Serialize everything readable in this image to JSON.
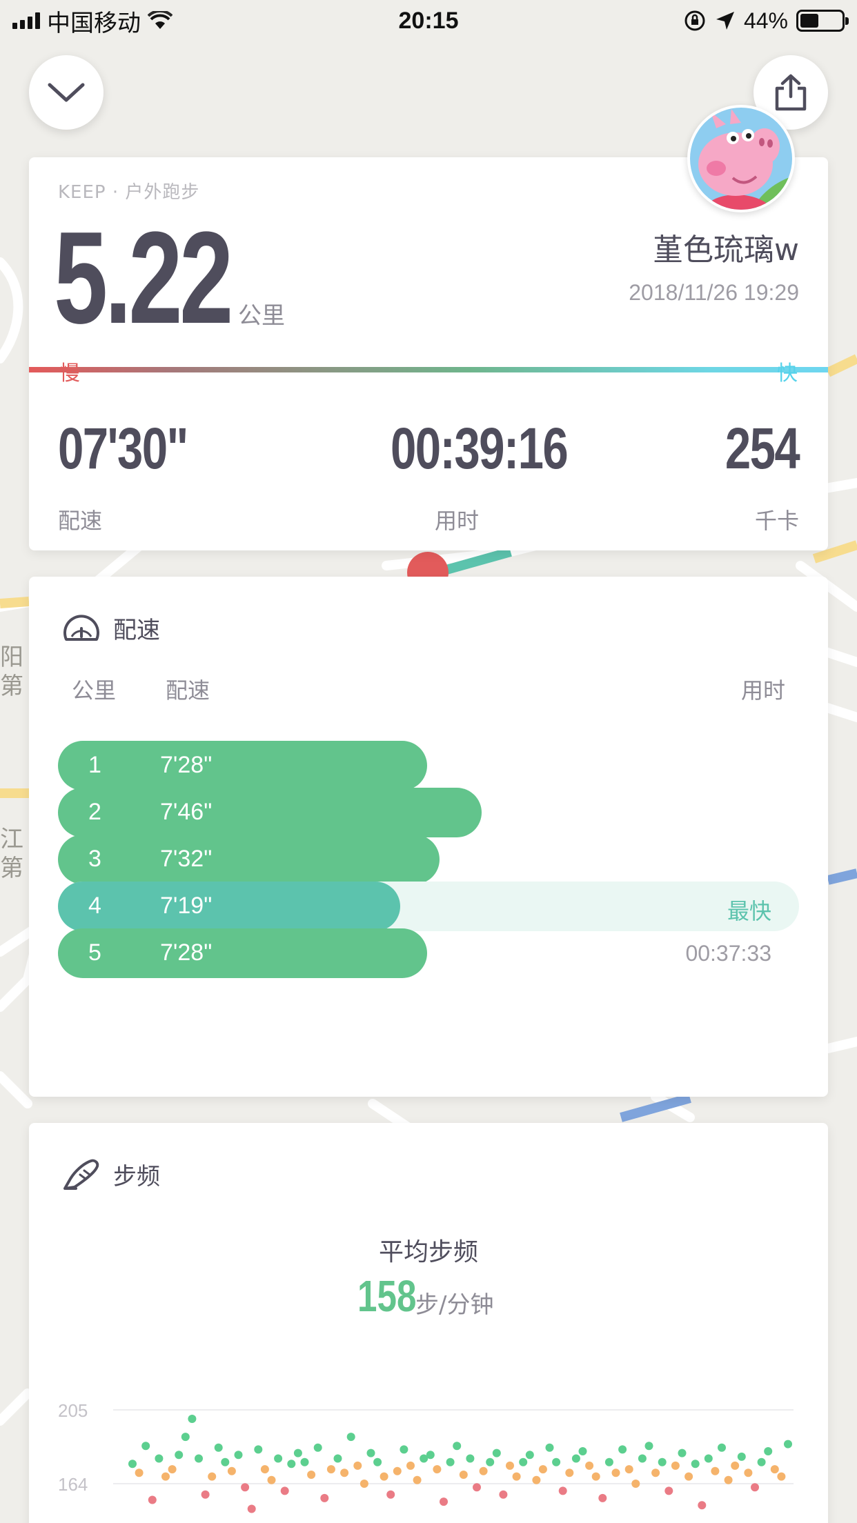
{
  "status_bar": {
    "carrier": "中国移动",
    "time": "20:15",
    "battery": "44%",
    "battery_level": 0.44
  },
  "icons": {
    "collapse": "chevron-down-icon",
    "share": "share-icon",
    "speedometer": "speedometer-icon",
    "shoe": "shoe-icon"
  },
  "summary": {
    "source": "KEEP · 户外跑步",
    "distance": "5.22",
    "distance_unit": "公里",
    "username": "堇色琉璃w",
    "datetime": "2018/11/26 19:29",
    "slow_label": "慢",
    "fast_label": "快",
    "stats": {
      "pace": {
        "value": "07'30\"",
        "label": "配速"
      },
      "duration": {
        "value": "00:39:16",
        "label": "用时"
      },
      "calories": {
        "value": "254",
        "label": "千卡"
      }
    }
  },
  "pace_card": {
    "title": "配速",
    "columns": {
      "km": "公里",
      "pace": "配速",
      "time": "用时"
    },
    "splits": [
      {
        "km": "1",
        "pace": "7'28\"",
        "seconds": 448,
        "note": ""
      },
      {
        "km": "2",
        "pace": "7'46\"",
        "seconds": 466,
        "note": ""
      },
      {
        "km": "3",
        "pace": "7'32\"",
        "seconds": 452,
        "note": ""
      },
      {
        "km": "4",
        "pace": "7'19\"",
        "seconds": 439,
        "note": "最快",
        "fastest": true
      },
      {
        "km": "5",
        "pace": "7'28\"",
        "seconds": 448,
        "note": "00:37:33"
      }
    ]
  },
  "cadence_card": {
    "title": "步频",
    "avg_title": "平均步频",
    "avg_value": "158",
    "avg_unit": "步/分钟",
    "colors": {
      "high": "#5ccf8f",
      "mid": "#f5b36b",
      "low": "#ea7b85"
    }
  },
  "chart_data": {
    "type": "scatter",
    "title": "",
    "xlabel": "",
    "ylabel": "",
    "y_ticks": [
      "205",
      "164"
    ],
    "ylim": [
      140,
      205
    ],
    "series": [
      {
        "name": "",
        "values": [
          175,
          170,
          185,
          155,
          178,
          168,
          172,
          180,
          190,
          200,
          178,
          158,
          168,
          184,
          176,
          171,
          180,
          162,
          150,
          183,
          172,
          166,
          178,
          160,
          175,
          181,
          176,
          169,
          184,
          156,
          172,
          178,
          170,
          190,
          174,
          164,
          181,
          176,
          168,
          158,
          171,
          183,
          174,
          166,
          178,
          180,
          172,
          154,
          176,
          185,
          169,
          178,
          162,
          171,
          176,
          181,
          158,
          174,
          168,
          176,
          180,
          166,
          172,
          184,
          176,
          160,
          170,
          178,
          182,
          174,
          168,
          156,
          176,
          170,
          183,
          172,
          164,
          178,
          185,
          170,
          176,
          160,
          174,
          181,
          168,
          175,
          152,
          178,
          171,
          184,
          166,
          174,
          179,
          170,
          162,
          176,
          182,
          172,
          168,
          186
        ]
      }
    ]
  }
}
